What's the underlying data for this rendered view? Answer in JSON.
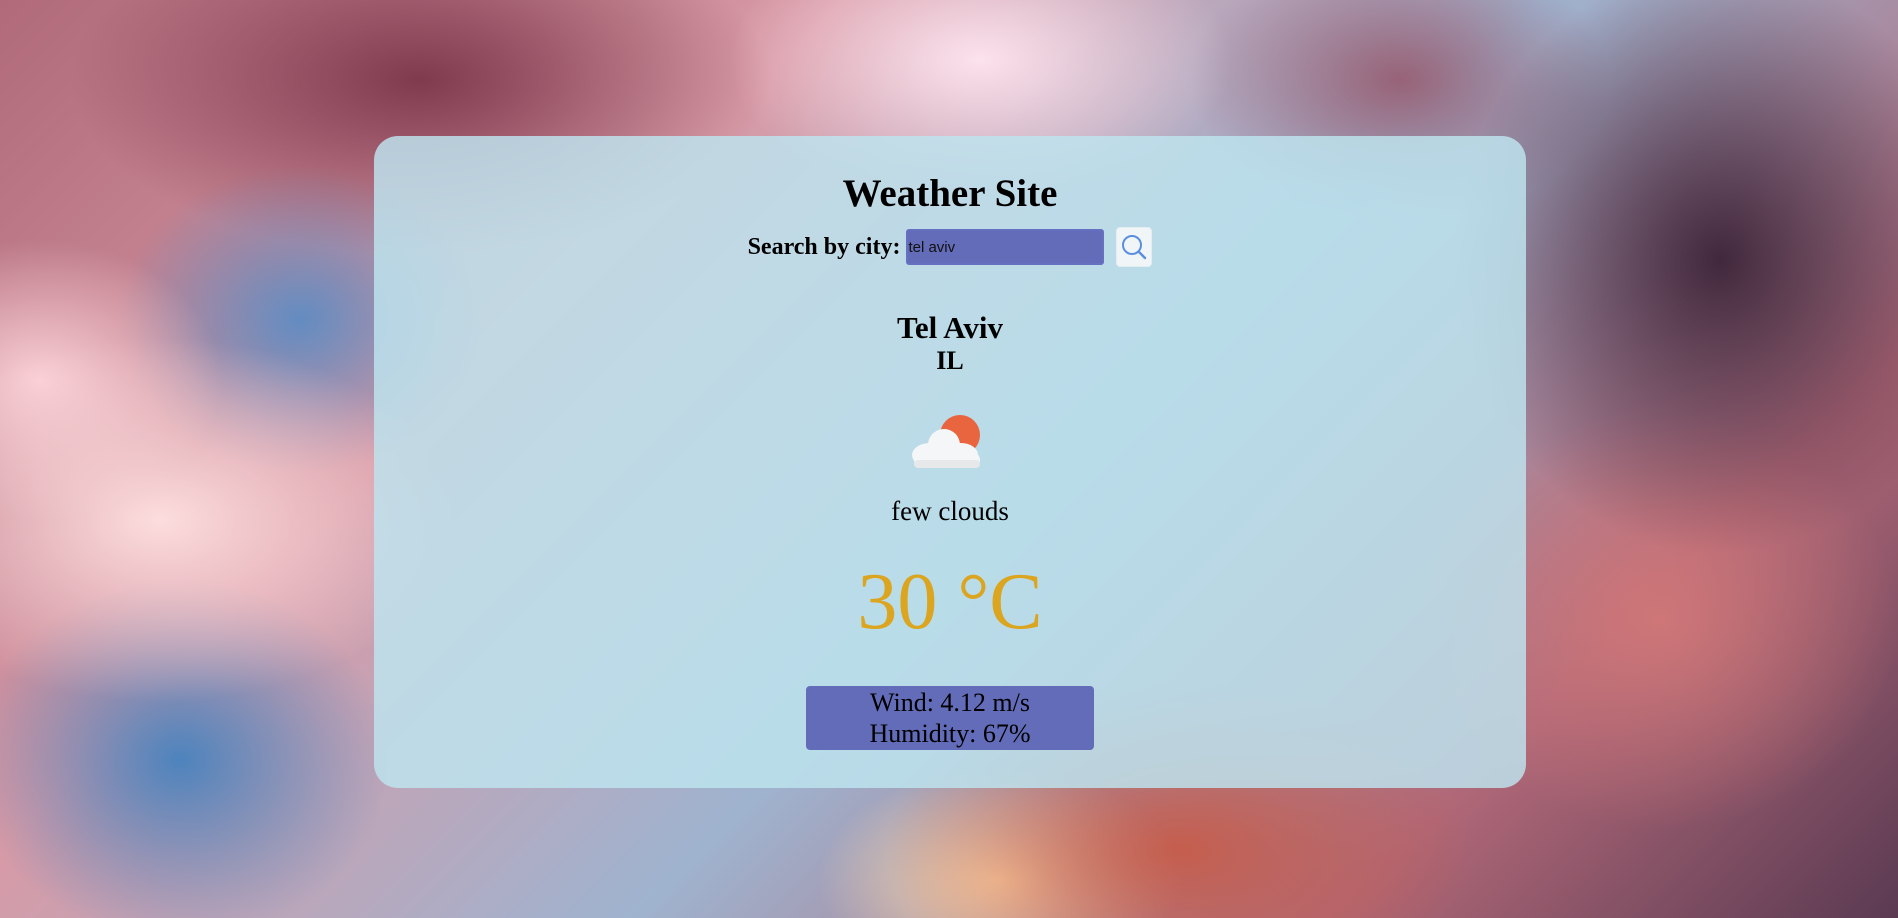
{
  "app": {
    "title": "Weather Site"
  },
  "search": {
    "label": "Search by city:",
    "value": "tel aviv",
    "placeholder": "",
    "button_icon": "search-icon"
  },
  "location": {
    "city": "Tel Aviv",
    "country": "IL"
  },
  "weather": {
    "icon": "few-clouds-icon",
    "description": "few clouds",
    "temperature": "30 °C",
    "wind": "Wind: 4.12 m/s",
    "humidity": "Humidity: 67%"
  },
  "colors": {
    "card_background": "#bee4ee",
    "accent_blue": "#626cb8",
    "temperature": "#dba520",
    "sun": "#e8653f"
  }
}
